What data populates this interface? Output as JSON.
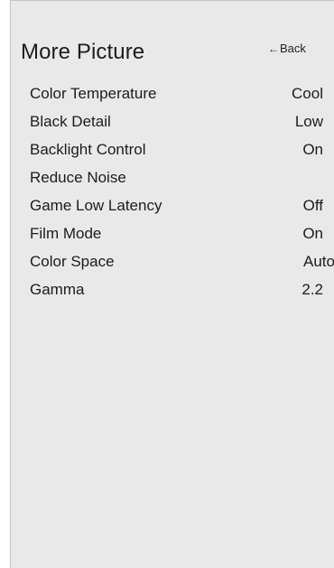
{
  "header": {
    "title": "More Picture",
    "back_arrow": "←",
    "back_label": "Back"
  },
  "menu": {
    "items": [
      {
        "label": "Color Temperature",
        "value": "Cool"
      },
      {
        "label": "Black Detail",
        "value": "Low"
      },
      {
        "label": "Backlight Control",
        "value": "On"
      },
      {
        "label": "Reduce Noise",
        "value": ""
      },
      {
        "label": "Game Low Latency",
        "value": "Off"
      },
      {
        "label": "Film Mode",
        "value": "On"
      },
      {
        "label": "Color Space",
        "value": "Auto"
      },
      {
        "label": "Gamma",
        "value": "2.2"
      }
    ]
  },
  "colors": {
    "panel_background": "#e9e9e9",
    "text": "#1c1c1c"
  }
}
